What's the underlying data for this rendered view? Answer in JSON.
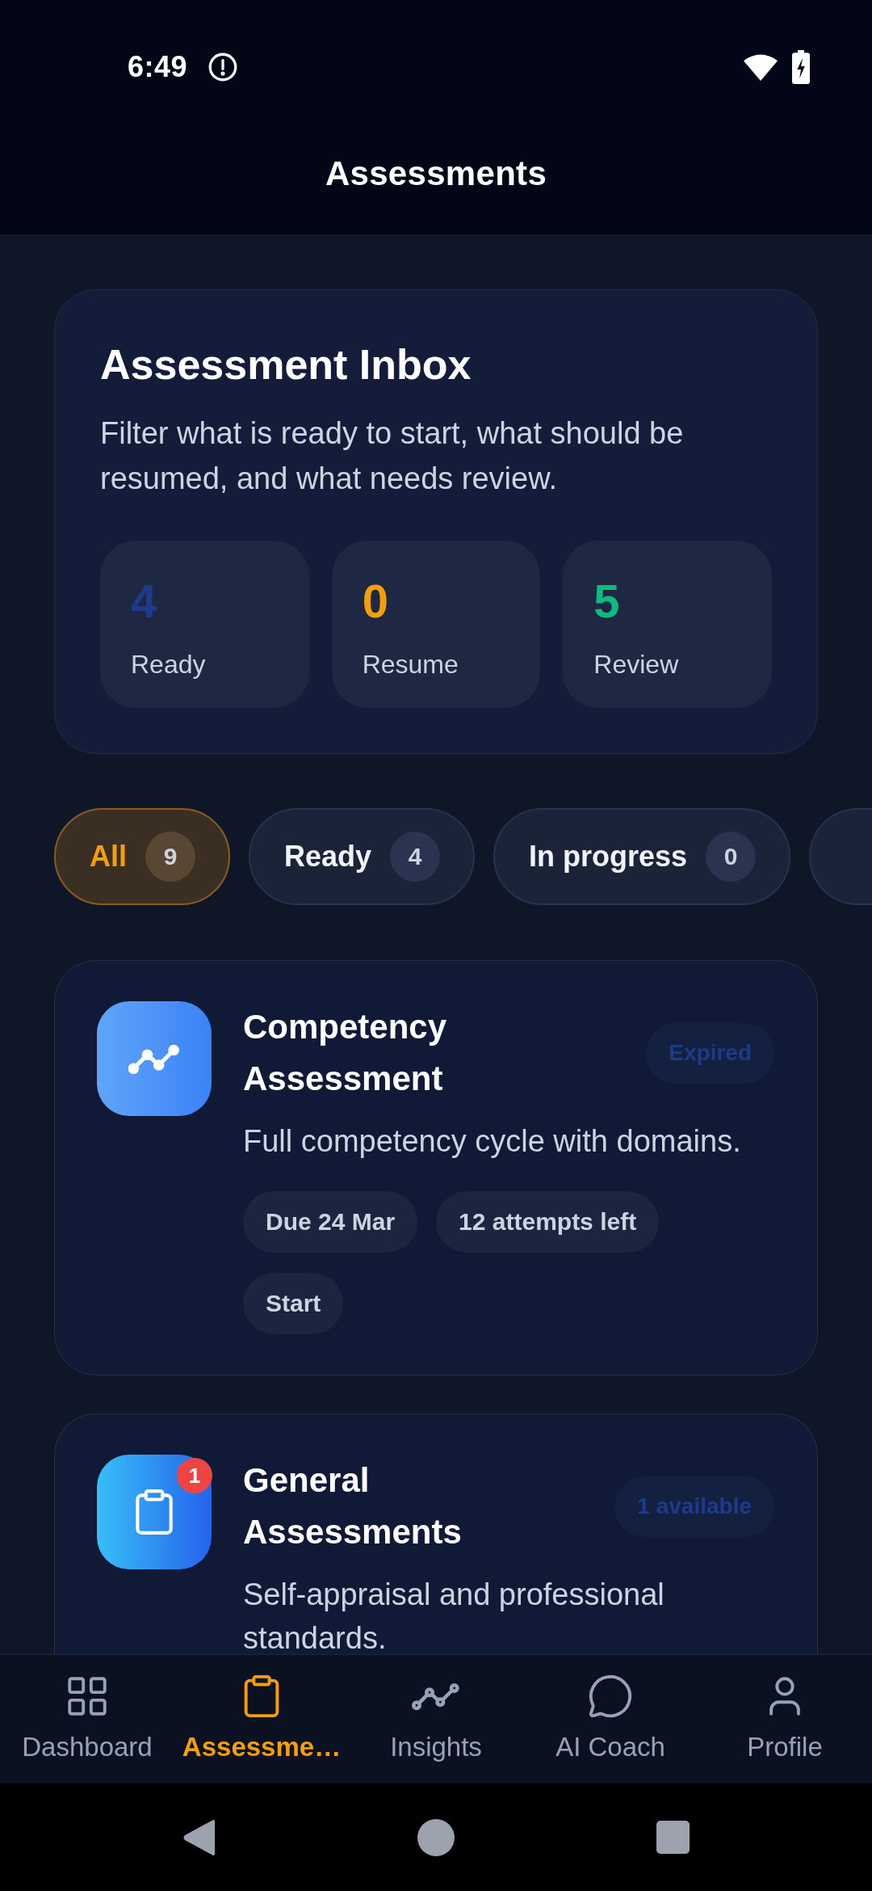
{
  "status_bar": {
    "time": "6:49"
  },
  "header": {
    "title": "Assessments"
  },
  "inbox": {
    "title": "Assessment Inbox",
    "description": "Filter what is ready to start, what should be resumed, and what needs review.",
    "stats": [
      {
        "value": "4",
        "label": "Ready",
        "color": "#1e3a8a"
      },
      {
        "value": "0",
        "label": "Resume",
        "color": "#f59e0b"
      },
      {
        "value": "5",
        "label": "Review",
        "color": "#10b981"
      }
    ]
  },
  "filters": [
    {
      "label": "All",
      "count": "9",
      "selected": true
    },
    {
      "label": "Ready",
      "count": "4",
      "selected": false
    },
    {
      "label": "In progress",
      "count": "0",
      "selected": false
    },
    {
      "selected": false
    }
  ],
  "assessments": [
    {
      "title": "Competency Assessment",
      "badge": "Expired",
      "description": "Full competency cycle with domains.",
      "chips": [
        "Due 24 Mar",
        "12 attempts left",
        "Start"
      ]
    },
    {
      "title": "General Assessments",
      "notification": "1",
      "badge": "1 available",
      "description": "Self-appraisal and professional standards."
    }
  ],
  "bottom_nav": [
    {
      "label": "Dashboard",
      "selected": false
    },
    {
      "label": "Assessme…",
      "selected": true
    },
    {
      "label": "Insights",
      "selected": false
    },
    {
      "label": "AI Coach",
      "selected": false
    },
    {
      "label": "Profile",
      "selected": false
    }
  ]
}
